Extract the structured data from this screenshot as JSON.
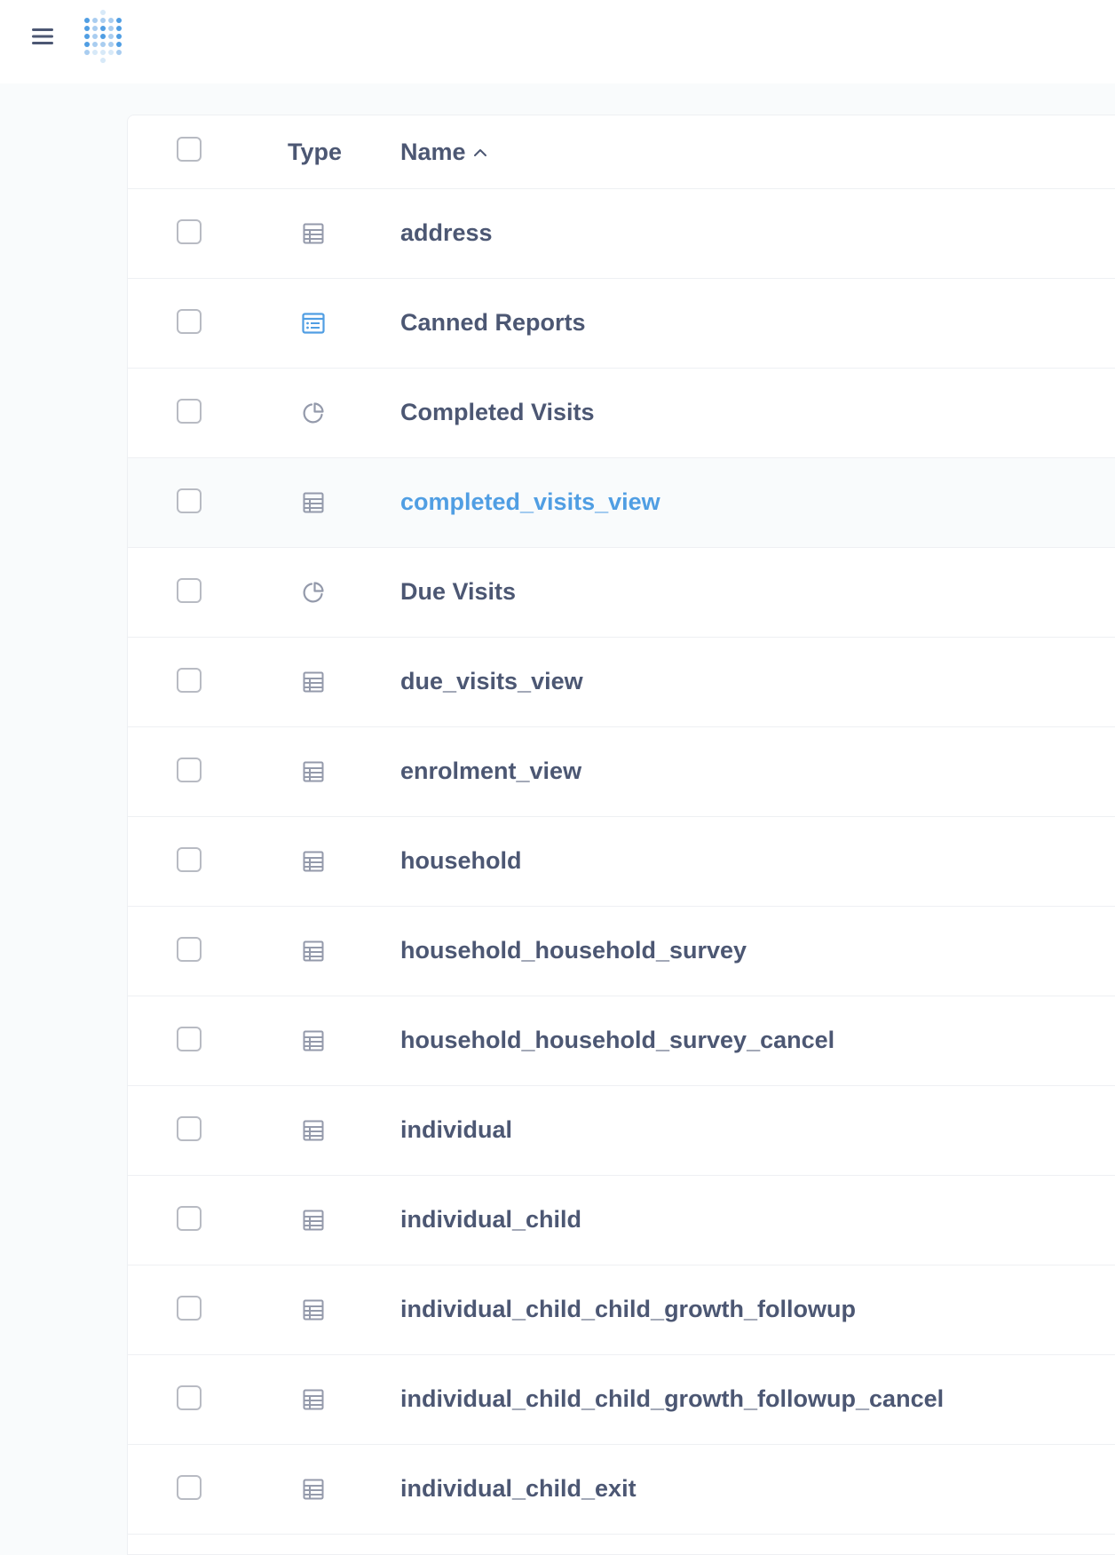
{
  "colors": {
    "accent": "#509ee3",
    "text": "#4c5773",
    "icon": "#949aab",
    "border": "#eef0f3"
  },
  "topbar": {
    "menu_icon": "hamburger-menu-icon",
    "logo_icon": "metabase-logo-icon"
  },
  "table": {
    "columns": {
      "type_label": "Type",
      "name_label": "Name",
      "sort": "ascending"
    },
    "rows": [
      {
        "name": "address",
        "type": "table"
      },
      {
        "name": "Canned Reports",
        "type": "dashboard"
      },
      {
        "name": "Completed Visits",
        "type": "question"
      },
      {
        "name": "completed_visits_view",
        "type": "table",
        "hovered": true
      },
      {
        "name": "Due Visits",
        "type": "question"
      },
      {
        "name": "due_visits_view",
        "type": "table"
      },
      {
        "name": "enrolment_view",
        "type": "table"
      },
      {
        "name": "household",
        "type": "table"
      },
      {
        "name": "household_household_survey",
        "type": "table"
      },
      {
        "name": "household_household_survey_cancel",
        "type": "table"
      },
      {
        "name": "individual",
        "type": "table"
      },
      {
        "name": "individual_child",
        "type": "table"
      },
      {
        "name": "individual_child_child_growth_followup",
        "type": "table"
      },
      {
        "name": "individual_child_child_growth_followup_cancel",
        "type": "table"
      },
      {
        "name": "individual_child_exit",
        "type": "table"
      }
    ]
  }
}
